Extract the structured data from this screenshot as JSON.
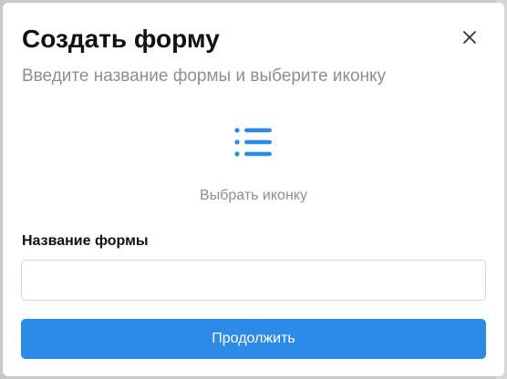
{
  "dialog": {
    "title": "Создать форму",
    "subtitle": "Введите название формы и выберите иконку",
    "close_icon": "close-icon",
    "icon_picker": {
      "icon": "list-icon",
      "label": "Выбрать иконку"
    },
    "form_name": {
      "label": "Название формы",
      "value": "",
      "placeholder": ""
    },
    "continue_label": "Продолжить"
  },
  "colors": {
    "accent": "#2b8be6",
    "muted_text": "#8a8f97",
    "title_text": "#111111",
    "backdrop": "#c9c9c9"
  }
}
